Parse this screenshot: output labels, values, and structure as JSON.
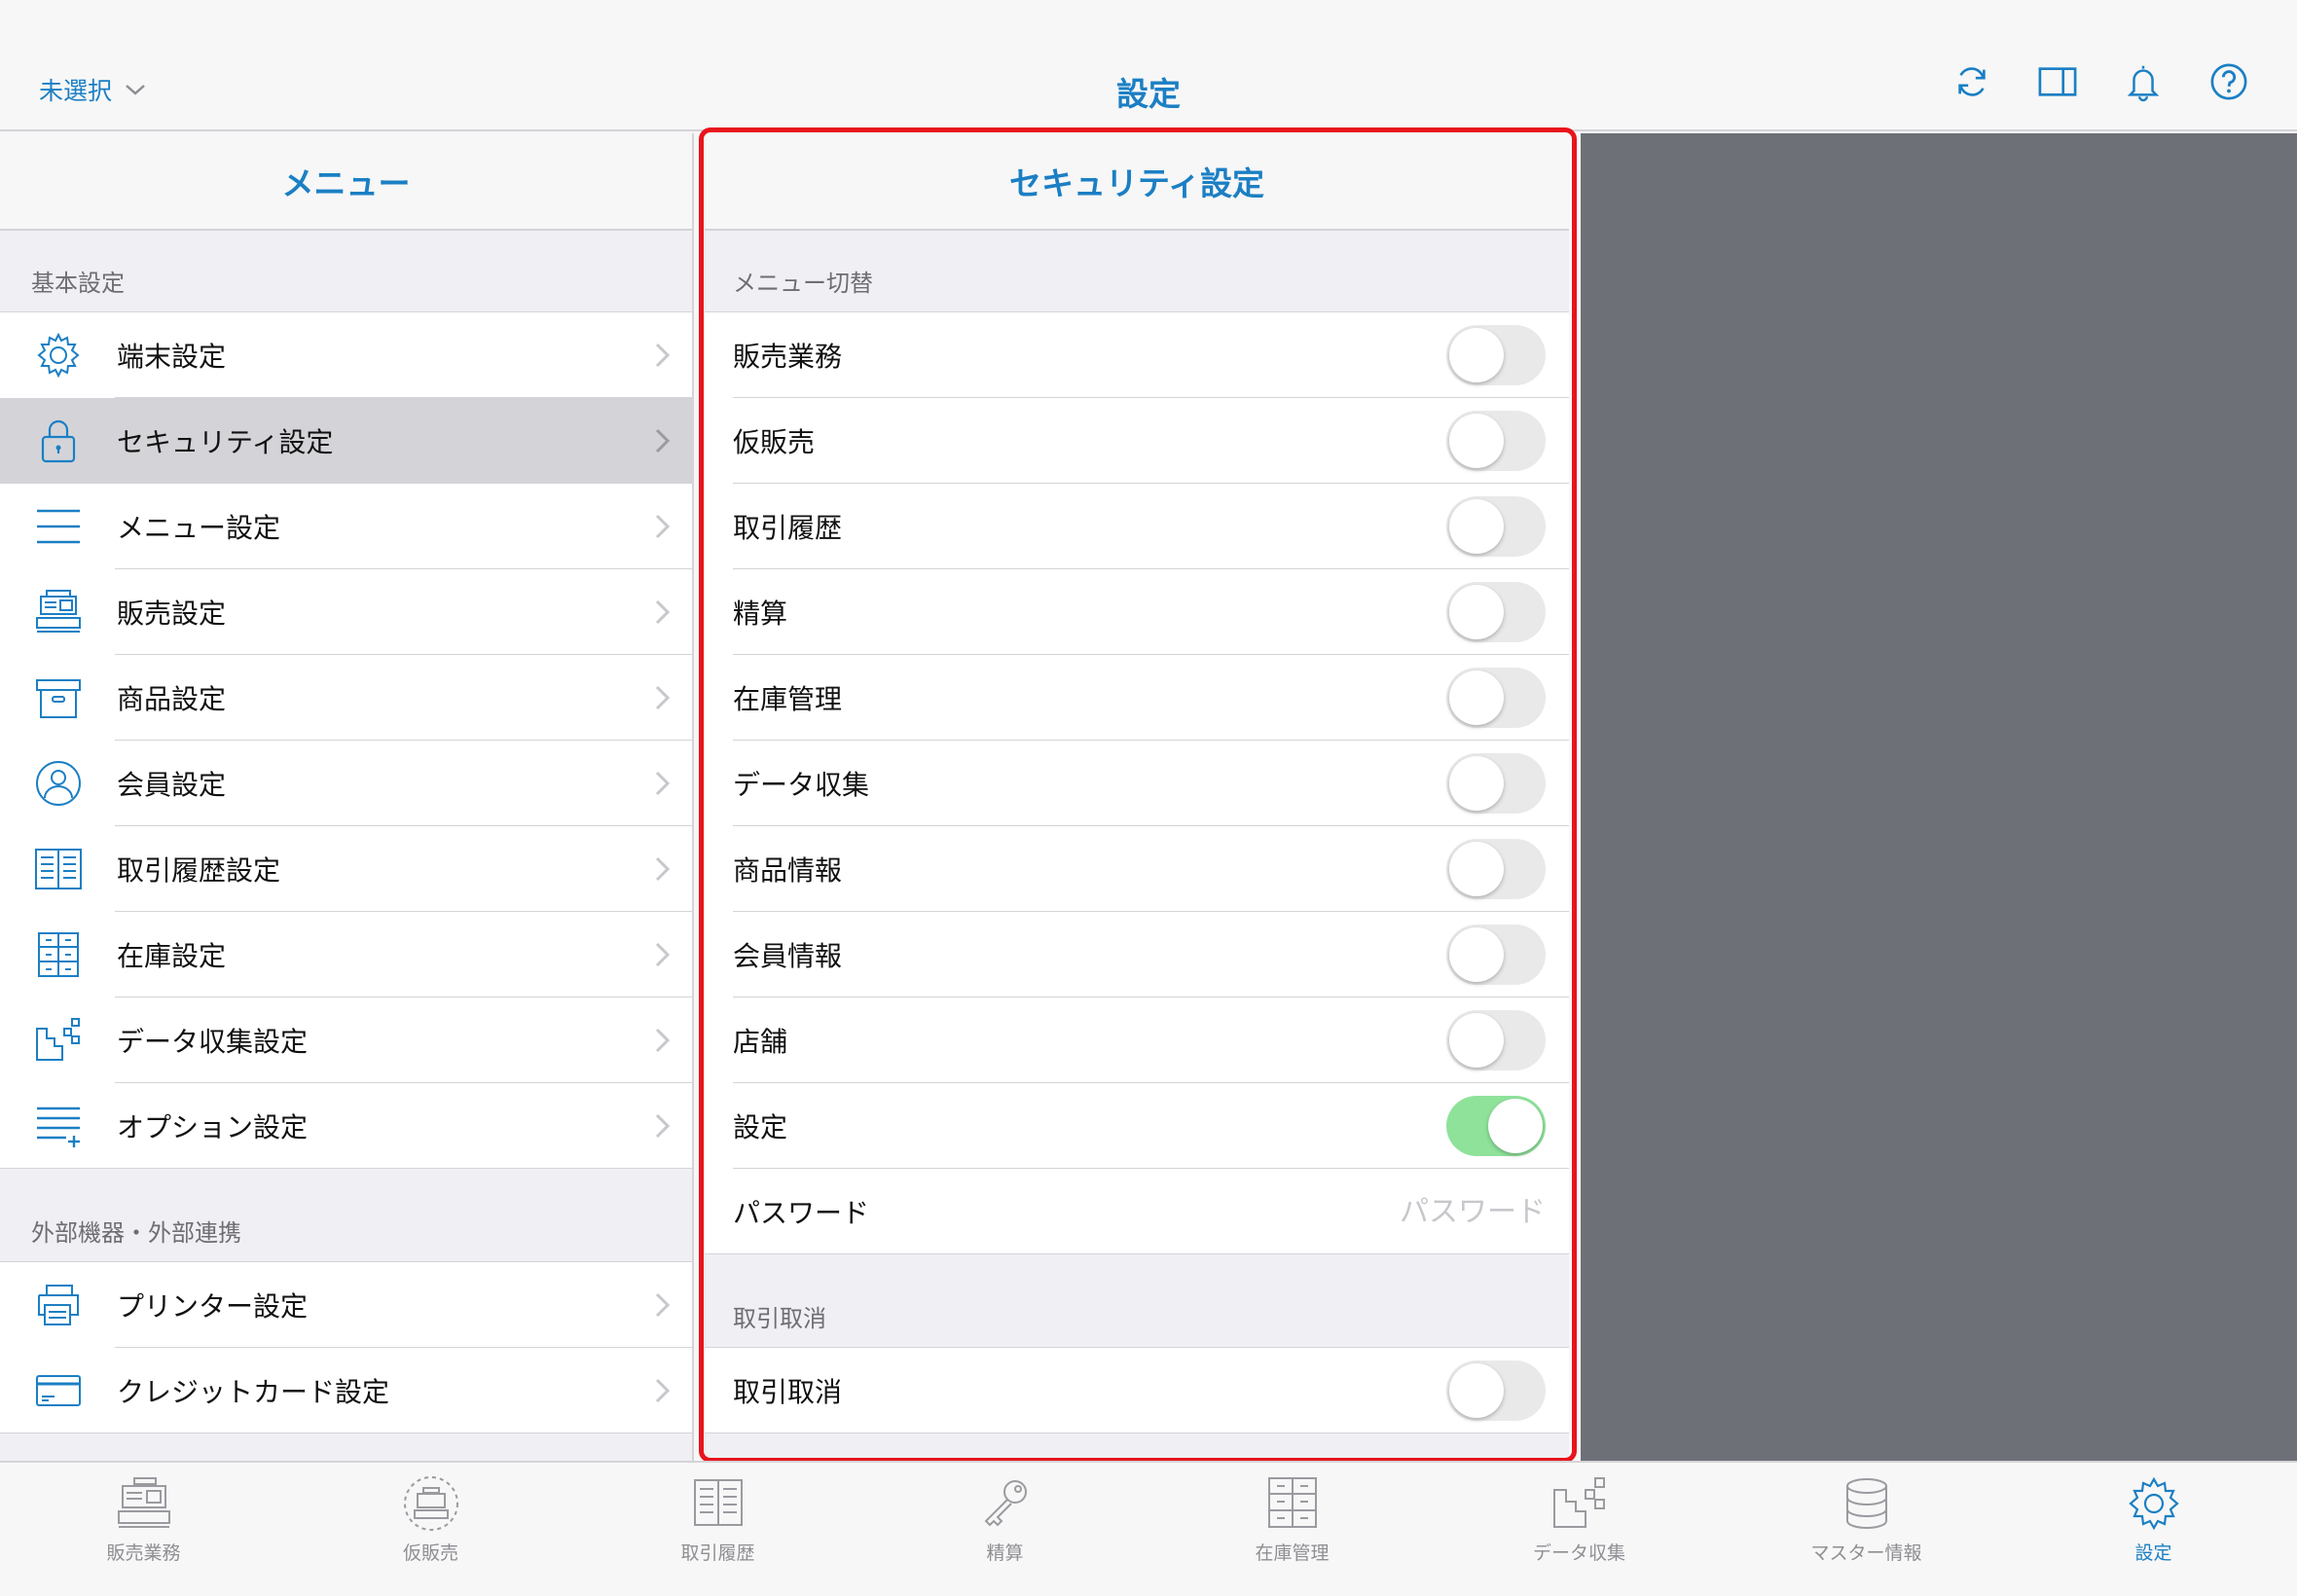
{
  "header": {
    "store_select": "未選択",
    "title": "設定"
  },
  "left_pane": {
    "title": "メニュー",
    "section1": "基本設定",
    "items": [
      {
        "label": "端末設定",
        "icon": "gear-icon"
      },
      {
        "label": "セキュリティ設定",
        "icon": "lock-icon",
        "selected": true
      },
      {
        "label": "メニュー設定",
        "icon": "menu-lines-icon"
      },
      {
        "label": "販売設定",
        "icon": "register-icon"
      },
      {
        "label": "商品設定",
        "icon": "box-icon"
      },
      {
        "label": "会員設定",
        "icon": "person-icon"
      },
      {
        "label": "取引履歴設定",
        "icon": "book-icon"
      },
      {
        "label": "在庫設定",
        "icon": "shelf-icon"
      },
      {
        "label": "データ収集設定",
        "icon": "data-collect-icon"
      },
      {
        "label": "オプション設定",
        "icon": "option-list-icon"
      }
    ],
    "section2": "外部機器・外部連携",
    "items2": [
      {
        "label": "プリンター設定",
        "icon": "printer-icon"
      },
      {
        "label": "クレジットカード設定",
        "icon": "credit-card-icon"
      }
    ]
  },
  "center_pane": {
    "title": "セキュリティ設定",
    "section1": "メニュー切替",
    "toggles": [
      {
        "label": "販売業務",
        "on": false
      },
      {
        "label": "仮販売",
        "on": false
      },
      {
        "label": "取引履歴",
        "on": false
      },
      {
        "label": "精算",
        "on": false
      },
      {
        "label": "在庫管理",
        "on": false
      },
      {
        "label": "データ収集",
        "on": false
      },
      {
        "label": "商品情報",
        "on": false
      },
      {
        "label": "会員情報",
        "on": false
      },
      {
        "label": "店舗",
        "on": false
      },
      {
        "label": "設定",
        "on": true
      }
    ],
    "password": {
      "label": "パスワード",
      "placeholder": "パスワード",
      "value": ""
    },
    "section2": "取引取消",
    "toggles2": [
      {
        "label": "取引取消",
        "on": false
      }
    ]
  },
  "tabbar": {
    "tabs": [
      {
        "label": "販売業務",
        "icon": "register-icon"
      },
      {
        "label": "仮販売",
        "icon": "temp-register-icon"
      },
      {
        "label": "取引履歴",
        "icon": "book-icon"
      },
      {
        "label": "精算",
        "icon": "key-icon"
      },
      {
        "label": "在庫管理",
        "icon": "shelf-icon"
      },
      {
        "label": "データ収集",
        "icon": "data-collect-icon"
      },
      {
        "label": "マスター情報",
        "icon": "database-icon"
      },
      {
        "label": "設定",
        "icon": "gear-icon",
        "active": true
      }
    ]
  },
  "colors": {
    "accent": "#1b7fc4",
    "toggle_on": "#8fe29a",
    "highlight": "#e8141c",
    "right_pane_bg": "#6d7077"
  }
}
